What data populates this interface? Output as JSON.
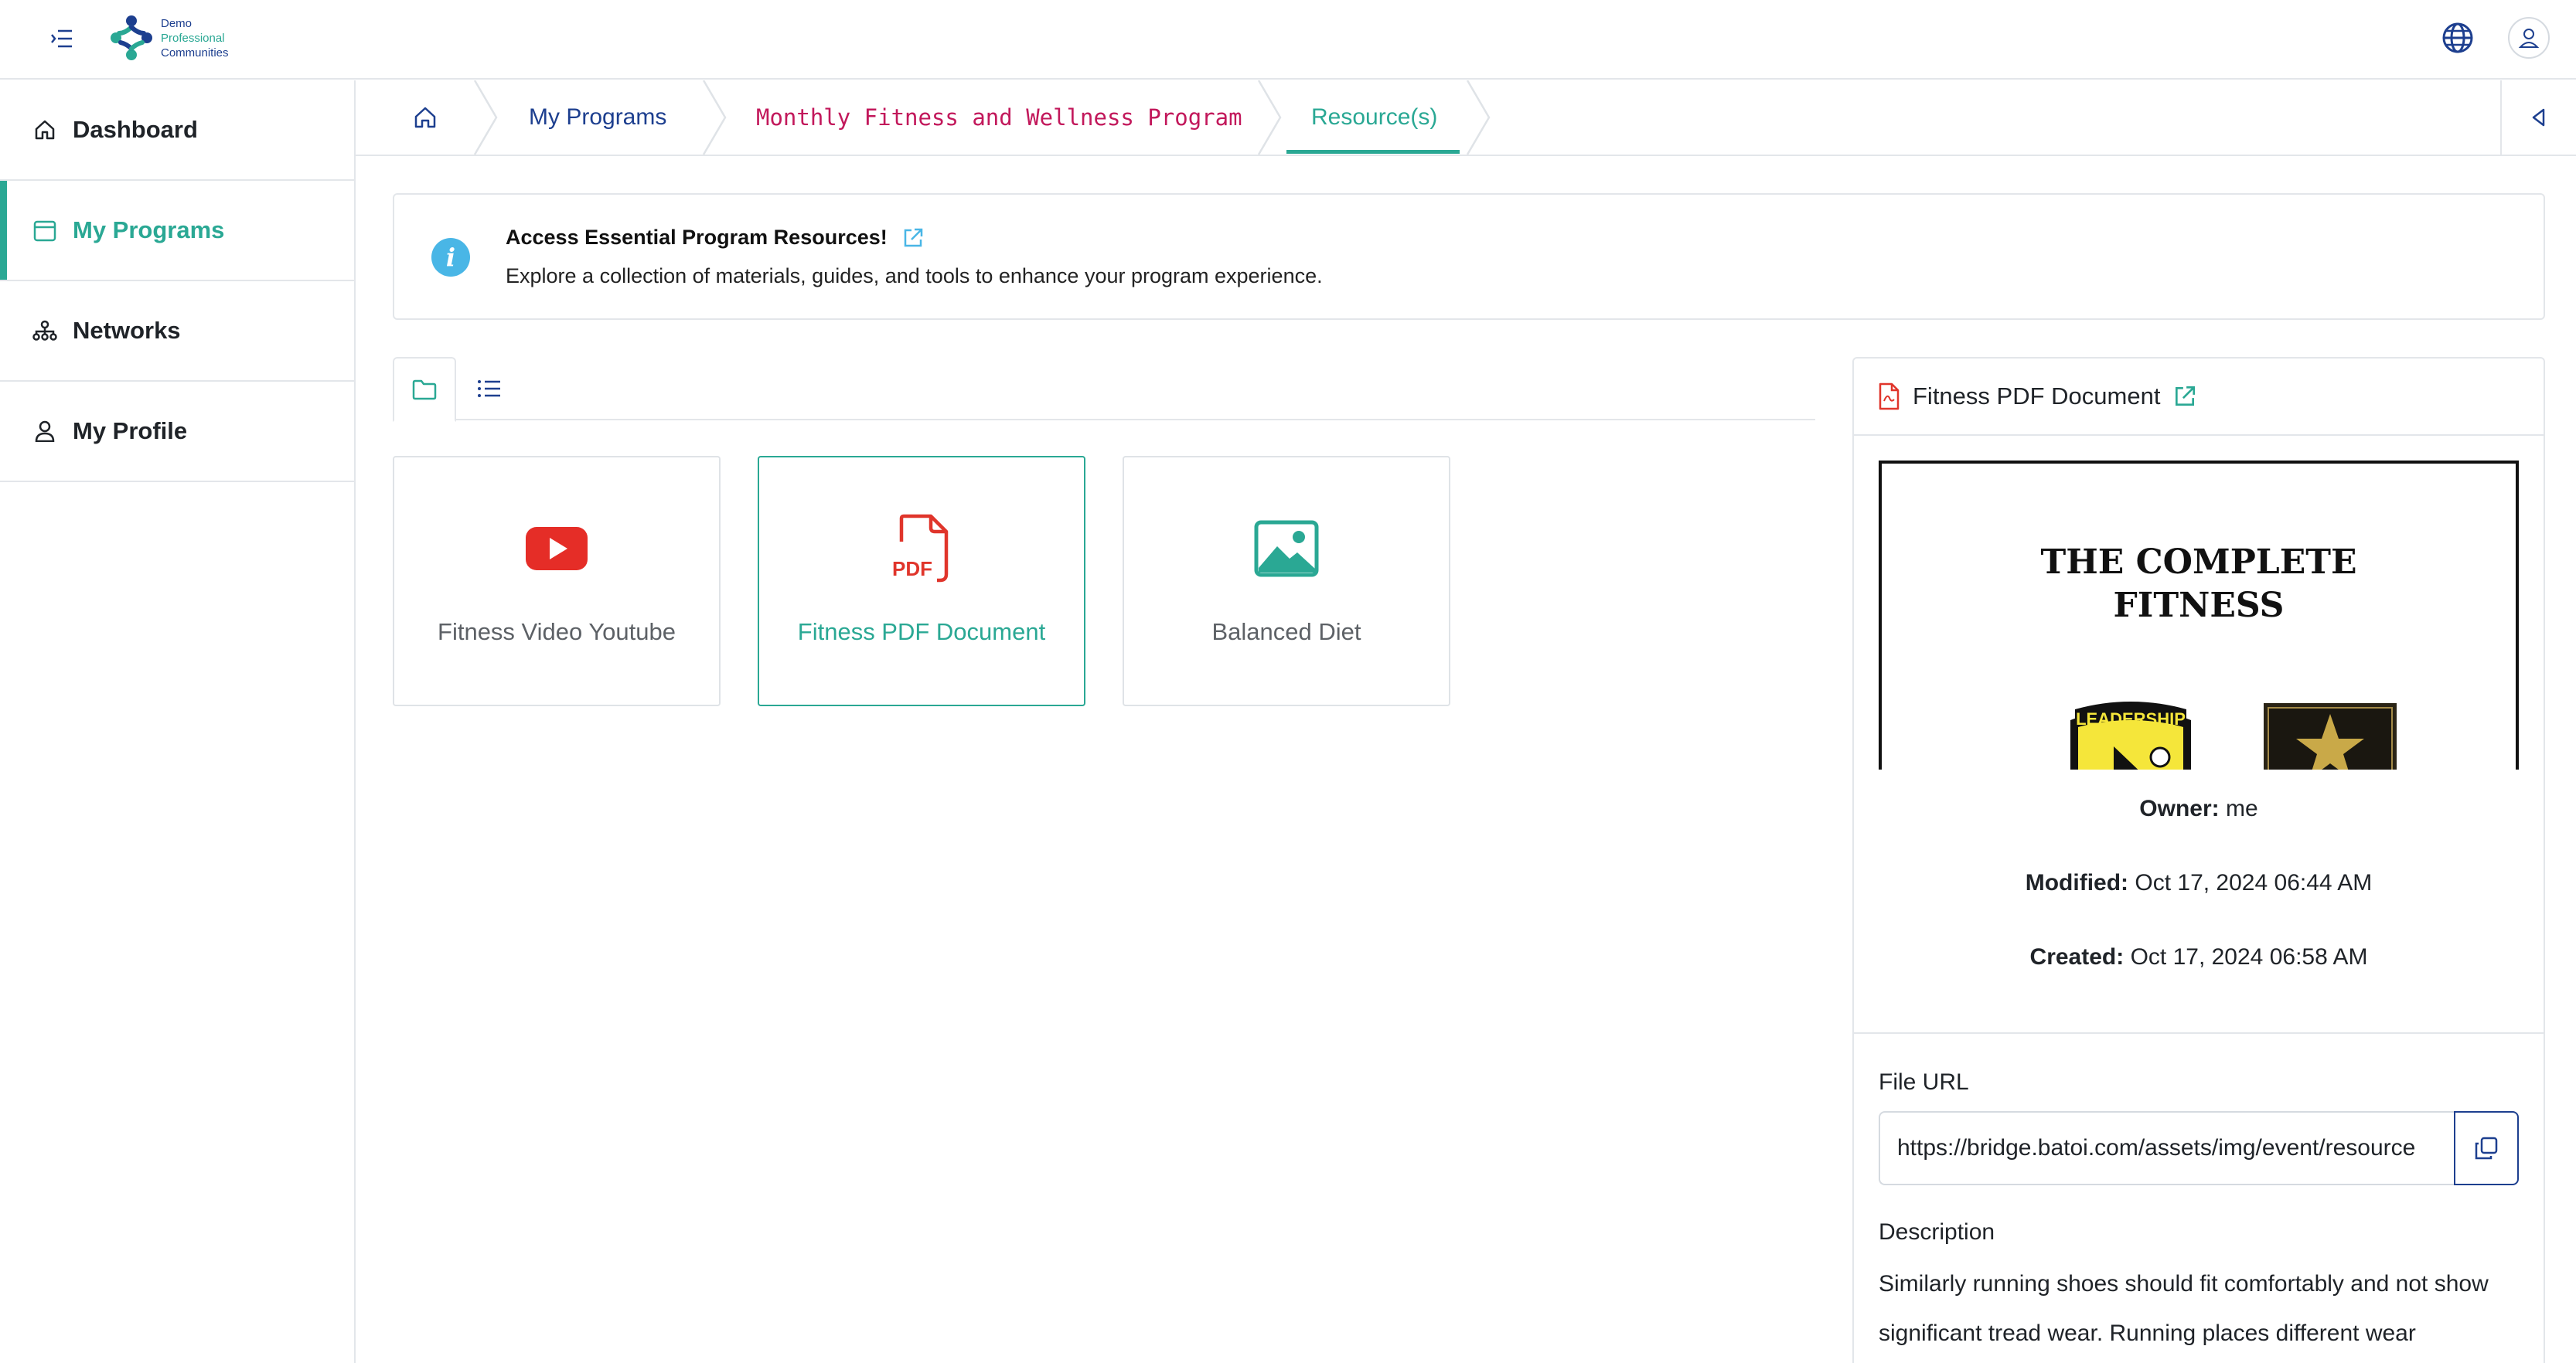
{
  "header": {
    "logo_text": [
      "Demo",
      "Professional",
      "Communities"
    ]
  },
  "sidebar": {
    "items": [
      {
        "label": "Dashboard",
        "icon": "home-icon"
      },
      {
        "label": "My Programs",
        "icon": "calendar-icon",
        "active": true
      },
      {
        "label": "Networks",
        "icon": "network-icon"
      },
      {
        "label": "My Profile",
        "icon": "user-icon"
      }
    ]
  },
  "breadcrumb": {
    "items": [
      "My Programs",
      "Monthly Fitness and Wellness Program",
      "Resource(s)"
    ]
  },
  "banner": {
    "title": "Access Essential Program Resources!",
    "description": "Explore a collection of materials, guides, and tools to enhance your program experience."
  },
  "resources": [
    {
      "label": "Fitness Video Youtube",
      "icon": "youtube-icon"
    },
    {
      "label": "Fitness PDF Document",
      "icon": "pdf-icon",
      "selected": true
    },
    {
      "label": "Balanced Diet",
      "icon": "image-icon"
    }
  ],
  "detail": {
    "title": "Fitness PDF Document",
    "preview_title": [
      "THE COMPLETE",
      "FITNESS"
    ],
    "preview_emblem_text": "LEADERSHIP",
    "owner_label": "Owner:",
    "owner_value": "me",
    "modified_label": "Modified:",
    "modified_value": "Oct 17, 2024 06:44 AM",
    "created_label": "Created:",
    "created_value": "Oct 17, 2024 06:58 AM",
    "file_url_label": "File URL",
    "file_url_value": "https://bridge.batoi.com/assets/img/event/resource",
    "description_label": "Description",
    "description_text": "Similarly running shoes should fit comfortably and not show significant tread wear. Running places different wear"
  },
  "colors": {
    "accent": "#2aa894",
    "navy": "#1d3f8f",
    "program_crumb": "#c2185b",
    "info": "#49b6e6",
    "youtube": "#e52d27",
    "pdf": "#e0352b"
  }
}
